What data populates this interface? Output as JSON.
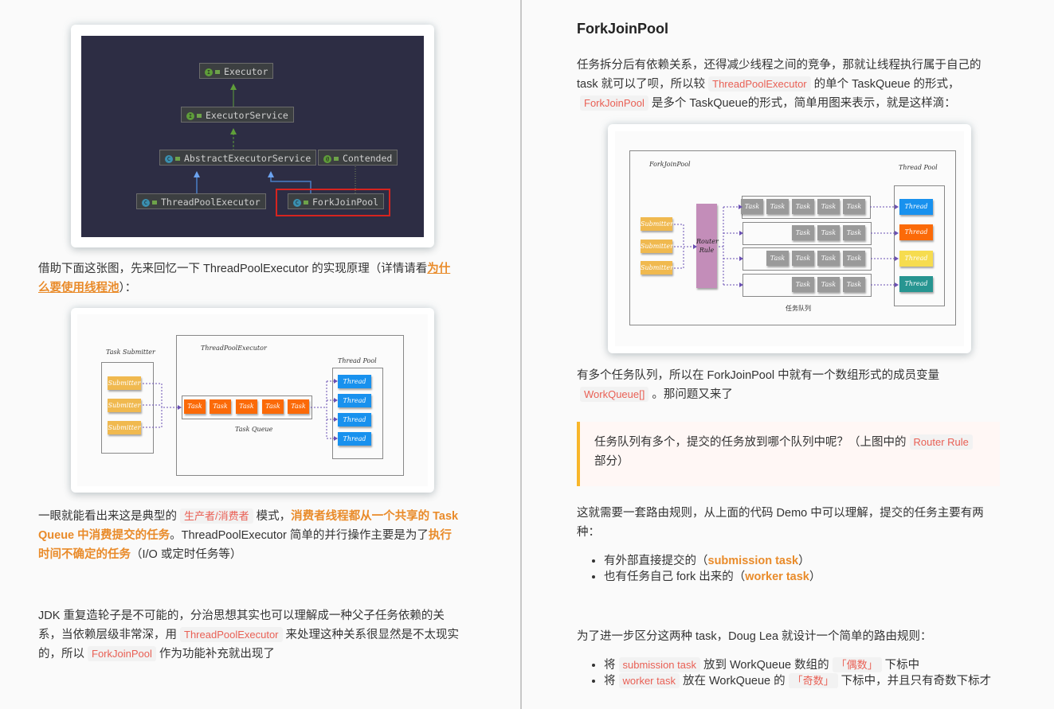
{
  "left_page": {
    "uml_diagram": {
      "nodes": {
        "executor": {
          "label": "Executor",
          "kind": "interface"
        },
        "executor_service": {
          "label": "ExecutorService",
          "kind": "interface"
        },
        "abstract_executor_service": {
          "label": "AbstractExecutorService",
          "kind": "abstract-class"
        },
        "contended": {
          "label": "Contended",
          "kind": "annotation"
        },
        "thread_pool_executor": {
          "label": "ThreadPoolExecutor",
          "kind": "class"
        },
        "fork_join_pool": {
          "label": "ForkJoinPool",
          "kind": "class",
          "highlighted": true
        }
      },
      "badge_letters": {
        "interface": "I",
        "class": "C",
        "annotation": "@"
      },
      "highlight_color": "#d6241f"
    },
    "para1": {
      "text_before": "借助下面这张图，先来回忆一下 ThreadPoolExecutor 的实现原理（详情请看",
      "link": "为什么要使用线程池",
      "text_after": "）："
    },
    "tpe_diagram": {
      "submitter_group_label": "Task Submitter",
      "executor_label": "ThreadPoolExecutor",
      "pool_label": "Thread Pool",
      "queue_label": "Task Queue",
      "submitters": [
        "Submitter",
        "Submitter",
        "Submitter"
      ],
      "tasks": [
        "Task",
        "Task",
        "Task",
        "Task",
        "Task"
      ],
      "threads": [
        "Thread",
        "Thread",
        "Thread",
        "Thread"
      ]
    },
    "para2": {
      "t1": "一眼就能看出来这是典型的",
      "code1": "生产者/消费者",
      "t2": "模式，",
      "hl1": "消费者线程都从一个共享的 Task Queue 中消费提交的任务",
      "t3": "。ThreadPoolExecutor 简单的并行操作主要是为了",
      "hl2": "执行时间不确定的任务",
      "t4": "（I/O 或定时任务等）"
    },
    "para3": {
      "t1": "JDK 重复造轮子是不可能的，分治思想其实也可以理解成一种父子任务依赖的关系，当依赖层级非常深，用",
      "code1": "ThreadPoolExecutor",
      "t2": "来处理这种关系很显然是不太现实的，所以",
      "code2": "ForkJoinPool",
      "t3": "作为功能补充就出现了"
    }
  },
  "right_page": {
    "heading": "ForkJoinPool",
    "para1": {
      "t1": "任务拆分后有依赖关系，还得减少线程之间的竞争，那就让线程执行属于自己的 task 就可以了呗，所以较",
      "code1": "ThreadPoolExecutor",
      "t2": "的单个 TaskQueue 的形式，",
      "code2": "ForkJoinPool",
      "t3": "是多个 TaskQueue的形式，简单用图来表示，就是这样滴："
    },
    "fjp_diagram": {
      "pool_label": "ForkJoinPool",
      "thread_pool_label": "Thread Pool",
      "router_label": "Router Rule",
      "queues_label": "任务队列",
      "submitters": [
        "Submitter",
        "Submitter",
        "Submitter"
      ],
      "queues": [
        {
          "tasks": [
            "Task",
            "Task",
            "Task",
            "Task",
            "Task"
          ]
        },
        {
          "tasks": [
            "Task",
            "Task",
            "Task"
          ]
        },
        {
          "tasks": [
            "Task",
            "Task",
            "Task",
            "Task"
          ]
        },
        {
          "tasks": [
            "Task",
            "Task",
            "Task"
          ]
        }
      ],
      "threads": [
        {
          "label": "Thread",
          "color": "#1891ee"
        },
        {
          "label": "Thread",
          "color": "#fb6a08"
        },
        {
          "label": "Thread",
          "color": "#f6dc4f"
        },
        {
          "label": "Thread",
          "color": "#279591"
        }
      ]
    },
    "para2": {
      "t1": "有多个任务队列，所以在 ForkJoinPool 中就有一个数组形式的成员变量",
      "code1": "WorkQueue[]",
      "t2": "。那问题又来了"
    },
    "quote": {
      "t1": "任务队列有多个，提交的任务放到哪个队列中呢？（上图中的",
      "code1": "Router Rule",
      "t2": "部分）"
    },
    "para3": "这就需要一套路由规则，从上面的代码 Demo 中可以理解，提交的任务主要有两种：",
    "list1": [
      {
        "t1": "有外部直接提交的（",
        "hl": "submission task",
        "t2": "）"
      },
      {
        "t1": "也有任务自己 fork 出来的（",
        "hl": "worker task",
        "t2": "）"
      }
    ],
    "para4": "为了进一步区分这两种 task，Doug Lea 就设计一个简单的路由规则：",
    "list2": [
      {
        "t1": "将",
        "code1": "submission task",
        "t2": "放到 WorkQueue 数组的",
        "code2": "「偶数」",
        "t3": "下标中"
      },
      {
        "t1": "将",
        "code1": "worker task",
        "t2": "放在 WorkQueue 的",
        "code2": "「奇数」",
        "t3": "下标中，并且只有奇数下标才"
      }
    ]
  },
  "colors": {
    "accent_orange": "#e98b2a",
    "code_red": "#e96055",
    "quote_bar": "#f8b62a",
    "uml_bg": "#2d2d44"
  }
}
